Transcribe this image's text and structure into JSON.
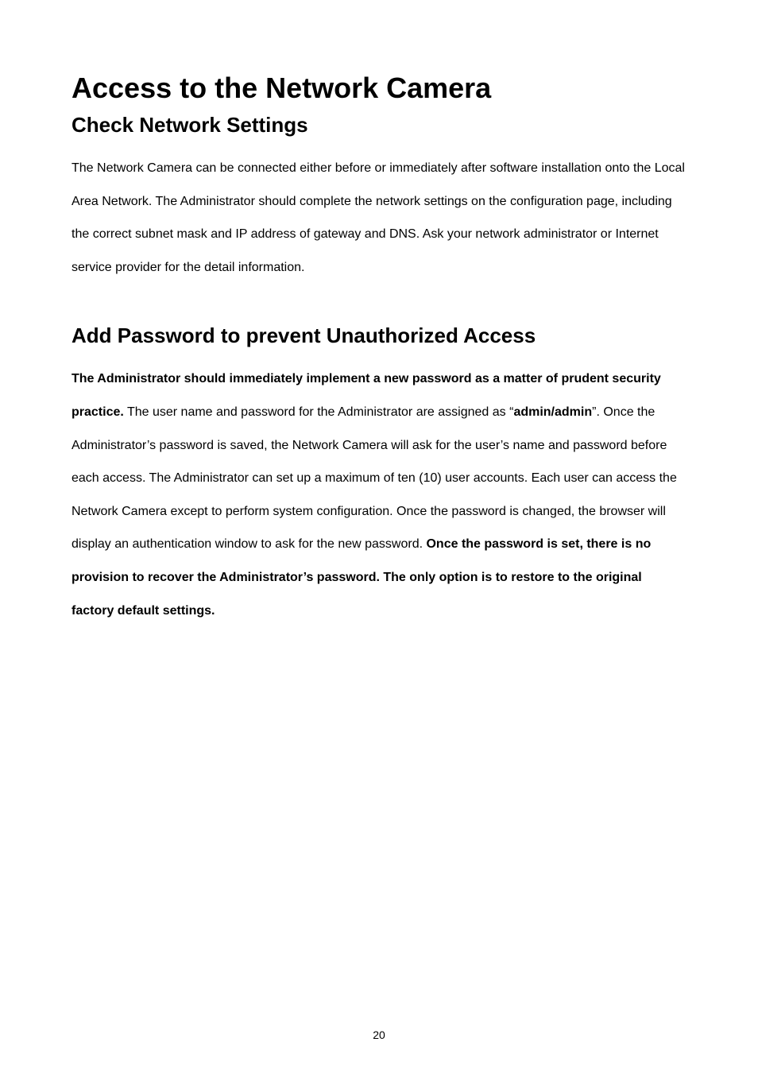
{
  "title": "Access to the Network Camera",
  "section1": {
    "heading": "Check Network Settings",
    "body": "The Network Camera can be connected either before or immediately after software installation onto the Local Area Network. The Administrator should complete the network settings on the configuration page, including the correct subnet mask and IP address of gateway and DNS. Ask your network administrator or Internet service provider for the detail information."
  },
  "section2": {
    "heading": "Add Password to prevent Unauthorized Access",
    "bold1": "The Administrator should immediately implement a new password as a matter of prudent security practice.",
    "text1": " The user name and password for the Administrator are assigned as “",
    "bold2": "admin/admin",
    "text2": "”. Once the Administrator’s password is saved, the Network Camera will ask for the user’s name and password before each access. The Administrator can set up a maximum of ten (10) user accounts. Each user can access the Network Camera except to perform system configuration.    Once the password is changed, the browser will display an authentication window to ask for the new password. ",
    "bold3": "Once the password is set, there is no provision to recover the Administrator’s password.    The only option is to restore to the original factory default settings."
  },
  "pageNumber": "20"
}
